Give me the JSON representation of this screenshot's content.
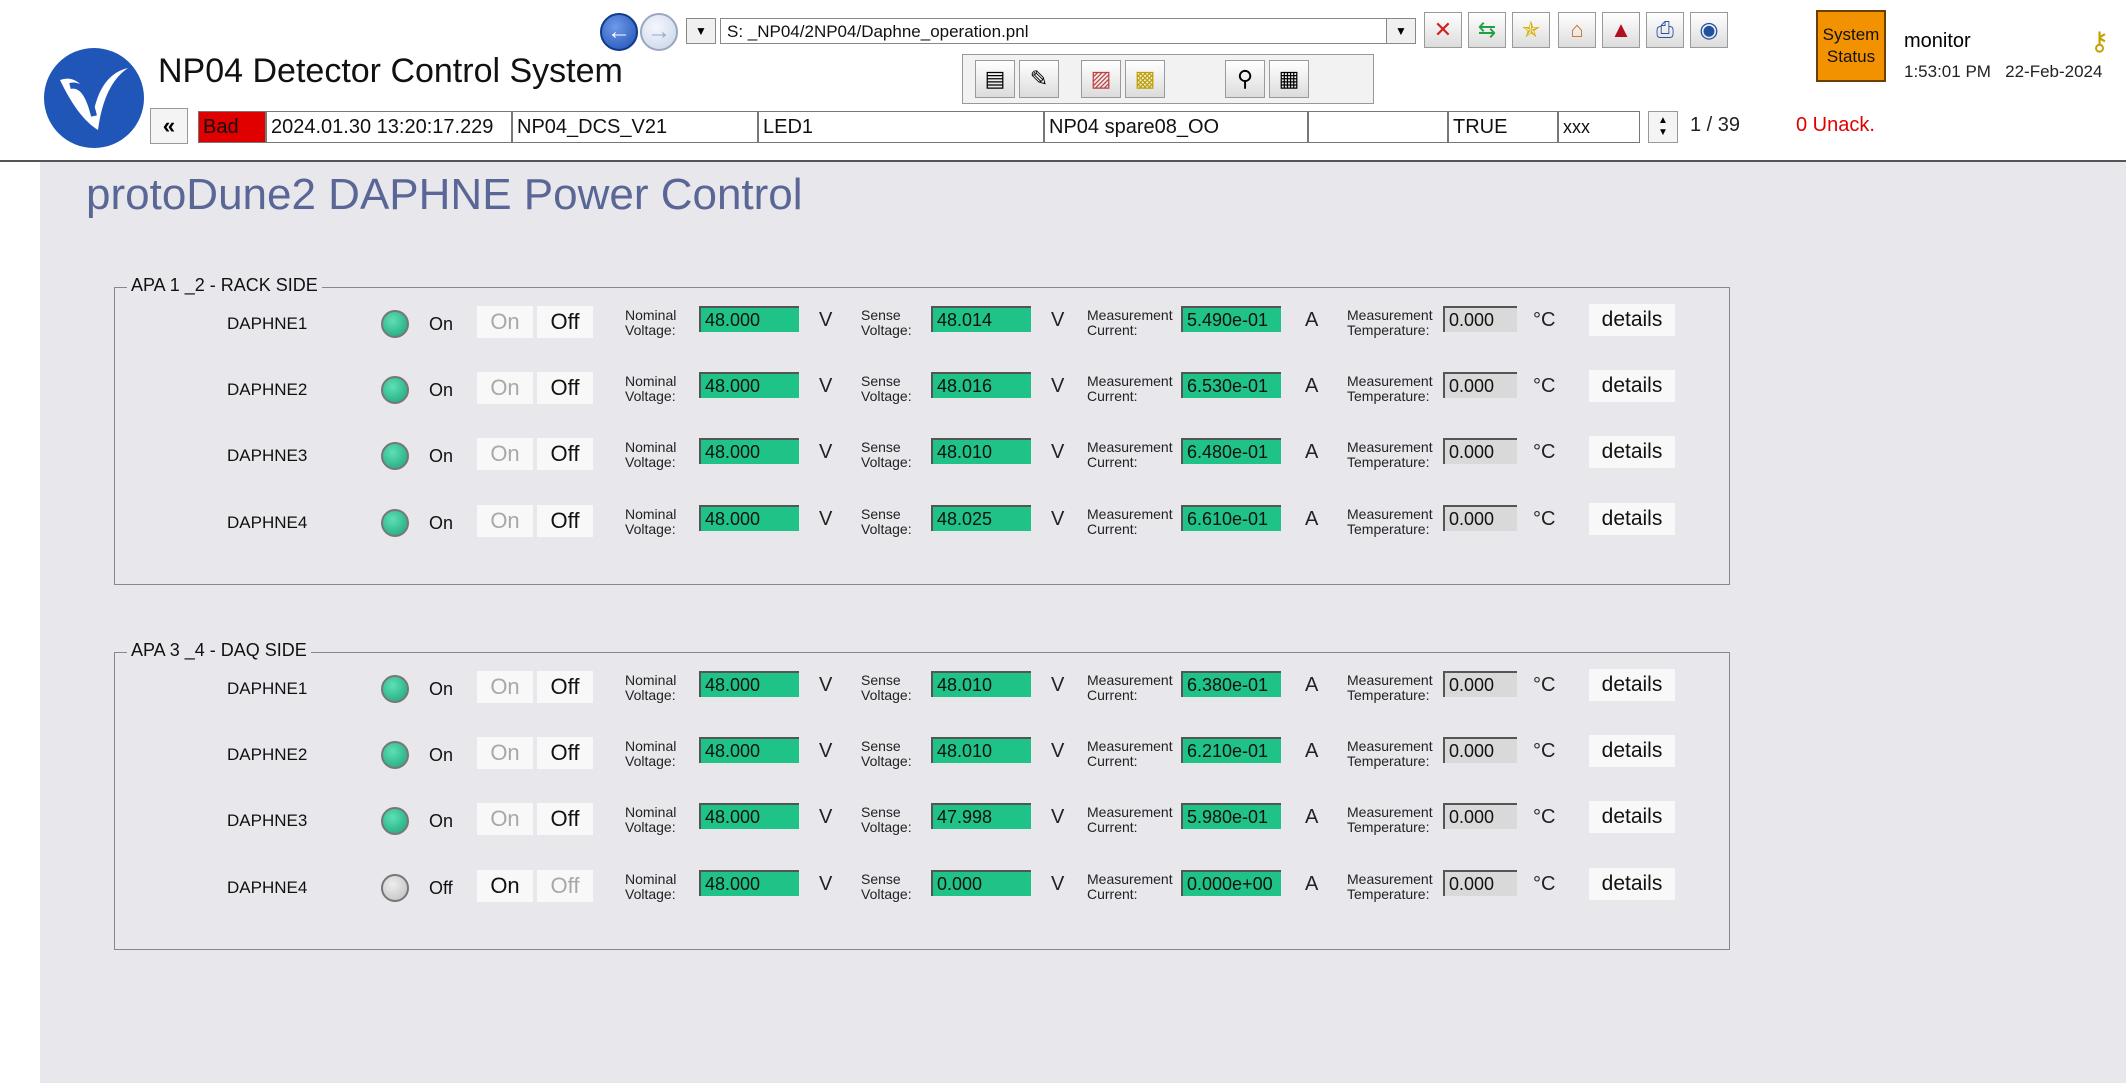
{
  "header": {
    "app_title": "NP04 Detector Control System",
    "panel_path": "S: _NP04/2NP04/Daphne_operation.pnl",
    "system_status_line1": "System",
    "system_status_line2": "Status",
    "user": "monitor",
    "time": "1:53:01 PM",
    "date": "22-Feb-2024",
    "toolbar_icons": [
      "close-icon",
      "refresh-icon",
      "star-icon",
      "home-icon",
      "trend-icon",
      "print-icon",
      "camera-icon"
    ],
    "toolbar2_icons": [
      "panel-tree-icon",
      "editor-icon",
      "log-icon",
      "settings-icon",
      "inspect-icon",
      "device-icon"
    ]
  },
  "alert_bar": {
    "collapse_label": "«",
    "status": "Bad",
    "timestamp": "2024.01.30 13:20:17.229",
    "system": "NP04_DCS_V21",
    "element": "LED1",
    "description": "NP04 spare08_OO",
    "extra": "",
    "value": "TRUE",
    "code": "xxx",
    "count": "1 / 39",
    "unack": "0 Unack."
  },
  "page": {
    "title": "protoDune2 DAPHNE Power Control",
    "labels": {
      "on": "On",
      "off": "Off",
      "nominal_1": "Nominal",
      "nominal_2": "Voltage:",
      "sense_1": "Sense",
      "sense_2": "Voltage:",
      "meas_1": "Measurement",
      "current_2": "Current:",
      "temp_2": "Temperature:",
      "unit_v": "V",
      "unit_a": "A",
      "unit_c": "°C",
      "details": "details"
    }
  },
  "groups": [
    {
      "title": "APA 1 _2 - RACK SIDE",
      "rows": [
        {
          "name": "DAPHNE1",
          "state": "On",
          "led": "on",
          "nominal": "48.000",
          "sense": "48.014",
          "current": "5.490e-01",
          "temp": "0.000"
        },
        {
          "name": "DAPHNE2",
          "state": "On",
          "led": "on",
          "nominal": "48.000",
          "sense": "48.016",
          "current": "6.530e-01",
          "temp": "0.000"
        },
        {
          "name": "DAPHNE3",
          "state": "On",
          "led": "on",
          "nominal": "48.000",
          "sense": "48.010",
          "current": "6.480e-01",
          "temp": "0.000"
        },
        {
          "name": "DAPHNE4",
          "state": "On",
          "led": "on",
          "nominal": "48.000",
          "sense": "48.025",
          "current": "6.610e-01",
          "temp": "0.000"
        }
      ]
    },
    {
      "title": "APA 3 _4 - DAQ SIDE",
      "rows": [
        {
          "name": "DAPHNE1",
          "state": "On",
          "led": "on",
          "nominal": "48.000",
          "sense": "48.010",
          "current": "6.380e-01",
          "temp": "0.000"
        },
        {
          "name": "DAPHNE2",
          "state": "On",
          "led": "on",
          "nominal": "48.000",
          "sense": "48.010",
          "current": "6.210e-01",
          "temp": "0.000"
        },
        {
          "name": "DAPHNE3",
          "state": "On",
          "led": "on",
          "nominal": "48.000",
          "sense": "47.998",
          "current": "5.980e-01",
          "temp": "0.000"
        },
        {
          "name": "DAPHNE4",
          "state": "Off",
          "led": "off",
          "nominal": "48.000",
          "sense": "0.000",
          "current": "0.000e+00",
          "temp": "0.000"
        }
      ]
    }
  ]
}
